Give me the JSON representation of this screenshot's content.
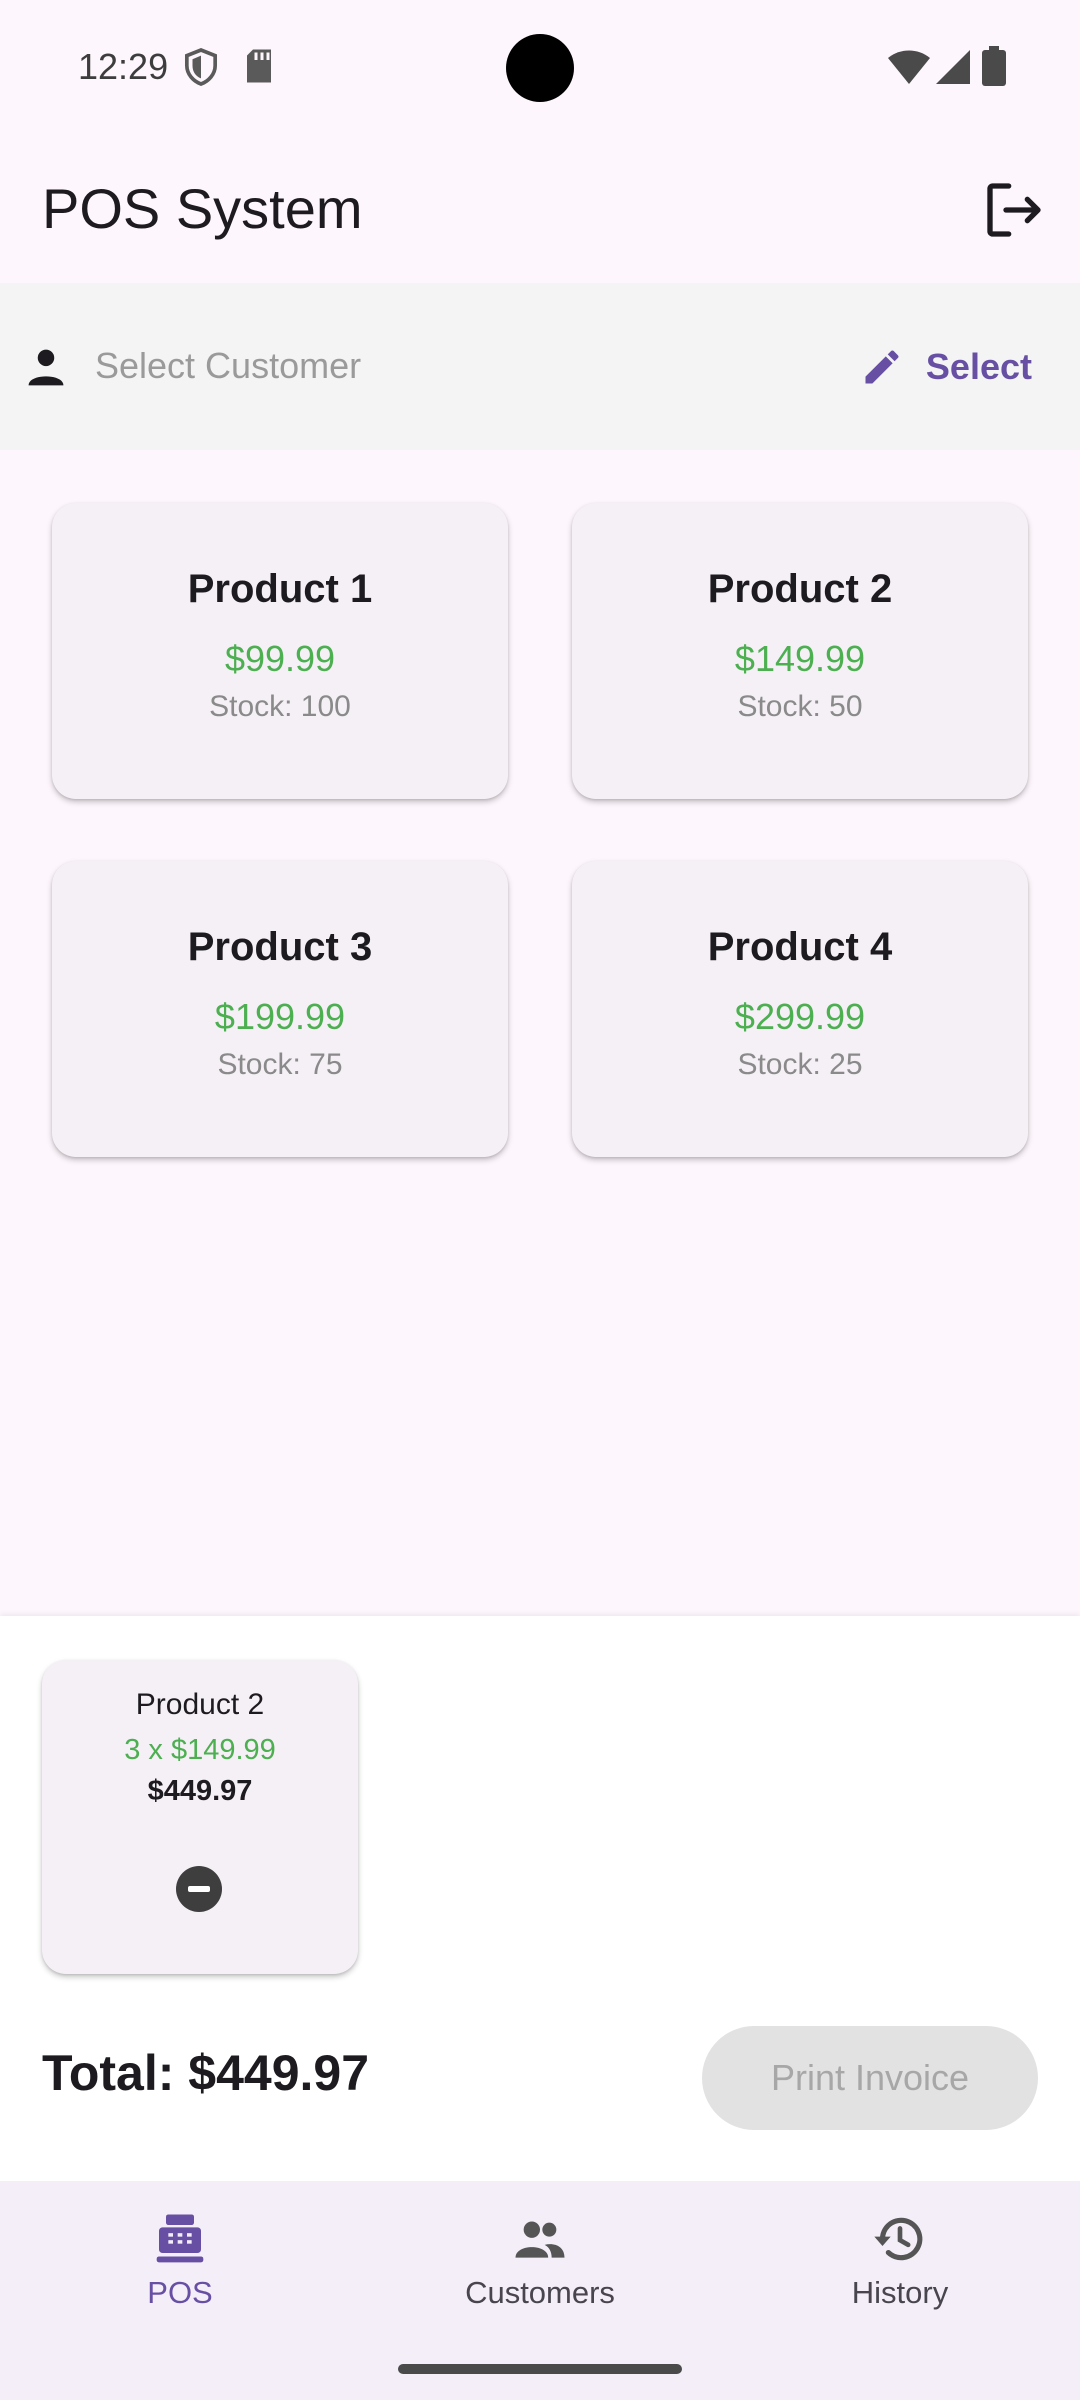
{
  "status": {
    "time": "12:29"
  },
  "app": {
    "title": "POS System"
  },
  "customer": {
    "placeholder": "Select Customer",
    "select_label": "Select"
  },
  "products": [
    {
      "name": "Product 1",
      "price": "$99.99",
      "stock": "Stock: 100"
    },
    {
      "name": "Product 2",
      "price": "$149.99",
      "stock": "Stock: 50"
    },
    {
      "name": "Product 3",
      "price": "$199.99",
      "stock": "Stock: 75"
    },
    {
      "name": "Product 4",
      "price": "$299.99",
      "stock": "Stock: 25"
    }
  ],
  "cart": {
    "items": [
      {
        "name": "Product 2",
        "qty_line": "3 x $149.99",
        "subtotal": "$449.97"
      }
    ],
    "total": "Total: $449.97",
    "print_label": "Print Invoice"
  },
  "nav": [
    {
      "label": "POS",
      "icon": "cash-register-icon",
      "active": true
    },
    {
      "label": "Customers",
      "icon": "people-icon",
      "active": false
    },
    {
      "label": "History",
      "icon": "history-icon",
      "active": false
    }
  ],
  "colors": {
    "accent": "#6750a4",
    "price": "#4caf50",
    "background": "#fdf6fc"
  }
}
